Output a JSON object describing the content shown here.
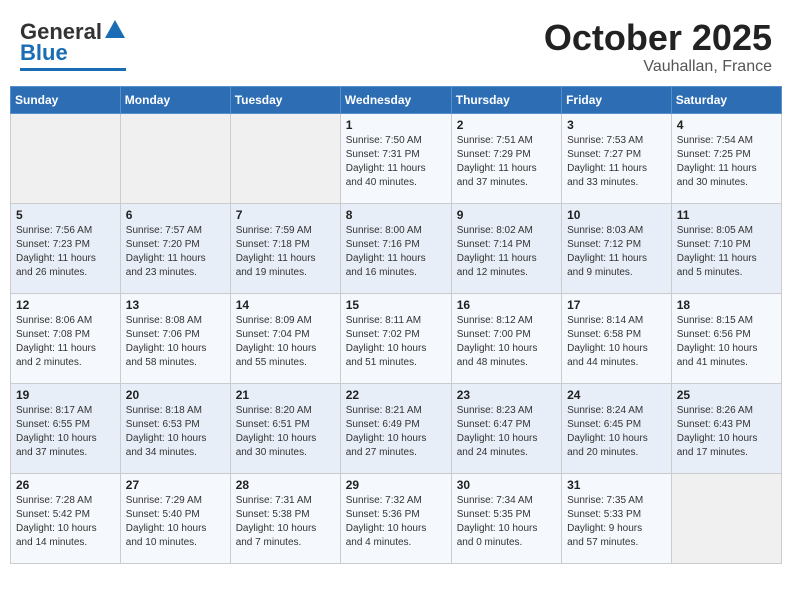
{
  "header": {
    "logo": {
      "general": "General",
      "blue": "Blue"
    },
    "title": "October 2025",
    "location": "Vauhallan, France"
  },
  "weekdays": [
    "Sunday",
    "Monday",
    "Tuesday",
    "Wednesday",
    "Thursday",
    "Friday",
    "Saturday"
  ],
  "weeks": [
    [
      {
        "day": "",
        "info": ""
      },
      {
        "day": "",
        "info": ""
      },
      {
        "day": "",
        "info": ""
      },
      {
        "day": "1",
        "info": "Sunrise: 7:50 AM\nSunset: 7:31 PM\nDaylight: 11 hours\nand 40 minutes."
      },
      {
        "day": "2",
        "info": "Sunrise: 7:51 AM\nSunset: 7:29 PM\nDaylight: 11 hours\nand 37 minutes."
      },
      {
        "day": "3",
        "info": "Sunrise: 7:53 AM\nSunset: 7:27 PM\nDaylight: 11 hours\nand 33 minutes."
      },
      {
        "day": "4",
        "info": "Sunrise: 7:54 AM\nSunset: 7:25 PM\nDaylight: 11 hours\nand 30 minutes."
      }
    ],
    [
      {
        "day": "5",
        "info": "Sunrise: 7:56 AM\nSunset: 7:23 PM\nDaylight: 11 hours\nand 26 minutes."
      },
      {
        "day": "6",
        "info": "Sunrise: 7:57 AM\nSunset: 7:20 PM\nDaylight: 11 hours\nand 23 minutes."
      },
      {
        "day": "7",
        "info": "Sunrise: 7:59 AM\nSunset: 7:18 PM\nDaylight: 11 hours\nand 19 minutes."
      },
      {
        "day": "8",
        "info": "Sunrise: 8:00 AM\nSunset: 7:16 PM\nDaylight: 11 hours\nand 16 minutes."
      },
      {
        "day": "9",
        "info": "Sunrise: 8:02 AM\nSunset: 7:14 PM\nDaylight: 11 hours\nand 12 minutes."
      },
      {
        "day": "10",
        "info": "Sunrise: 8:03 AM\nSunset: 7:12 PM\nDaylight: 11 hours\nand 9 minutes."
      },
      {
        "day": "11",
        "info": "Sunrise: 8:05 AM\nSunset: 7:10 PM\nDaylight: 11 hours\nand 5 minutes."
      }
    ],
    [
      {
        "day": "12",
        "info": "Sunrise: 8:06 AM\nSunset: 7:08 PM\nDaylight: 11 hours\nand 2 minutes."
      },
      {
        "day": "13",
        "info": "Sunrise: 8:08 AM\nSunset: 7:06 PM\nDaylight: 10 hours\nand 58 minutes."
      },
      {
        "day": "14",
        "info": "Sunrise: 8:09 AM\nSunset: 7:04 PM\nDaylight: 10 hours\nand 55 minutes."
      },
      {
        "day": "15",
        "info": "Sunrise: 8:11 AM\nSunset: 7:02 PM\nDaylight: 10 hours\nand 51 minutes."
      },
      {
        "day": "16",
        "info": "Sunrise: 8:12 AM\nSunset: 7:00 PM\nDaylight: 10 hours\nand 48 minutes."
      },
      {
        "day": "17",
        "info": "Sunrise: 8:14 AM\nSunset: 6:58 PM\nDaylight: 10 hours\nand 44 minutes."
      },
      {
        "day": "18",
        "info": "Sunrise: 8:15 AM\nSunset: 6:56 PM\nDaylight: 10 hours\nand 41 minutes."
      }
    ],
    [
      {
        "day": "19",
        "info": "Sunrise: 8:17 AM\nSunset: 6:55 PM\nDaylight: 10 hours\nand 37 minutes."
      },
      {
        "day": "20",
        "info": "Sunrise: 8:18 AM\nSunset: 6:53 PM\nDaylight: 10 hours\nand 34 minutes."
      },
      {
        "day": "21",
        "info": "Sunrise: 8:20 AM\nSunset: 6:51 PM\nDaylight: 10 hours\nand 30 minutes."
      },
      {
        "day": "22",
        "info": "Sunrise: 8:21 AM\nSunset: 6:49 PM\nDaylight: 10 hours\nand 27 minutes."
      },
      {
        "day": "23",
        "info": "Sunrise: 8:23 AM\nSunset: 6:47 PM\nDaylight: 10 hours\nand 24 minutes."
      },
      {
        "day": "24",
        "info": "Sunrise: 8:24 AM\nSunset: 6:45 PM\nDaylight: 10 hours\nand 20 minutes."
      },
      {
        "day": "25",
        "info": "Sunrise: 8:26 AM\nSunset: 6:43 PM\nDaylight: 10 hours\nand 17 minutes."
      }
    ],
    [
      {
        "day": "26",
        "info": "Sunrise: 7:28 AM\nSunset: 5:42 PM\nDaylight: 10 hours\nand 14 minutes."
      },
      {
        "day": "27",
        "info": "Sunrise: 7:29 AM\nSunset: 5:40 PM\nDaylight: 10 hours\nand 10 minutes."
      },
      {
        "day": "28",
        "info": "Sunrise: 7:31 AM\nSunset: 5:38 PM\nDaylight: 10 hours\nand 7 minutes."
      },
      {
        "day": "29",
        "info": "Sunrise: 7:32 AM\nSunset: 5:36 PM\nDaylight: 10 hours\nand 4 minutes."
      },
      {
        "day": "30",
        "info": "Sunrise: 7:34 AM\nSunset: 5:35 PM\nDaylight: 10 hours\nand 0 minutes."
      },
      {
        "day": "31",
        "info": "Sunrise: 7:35 AM\nSunset: 5:33 PM\nDaylight: 9 hours\nand 57 minutes."
      },
      {
        "day": "",
        "info": ""
      }
    ]
  ]
}
